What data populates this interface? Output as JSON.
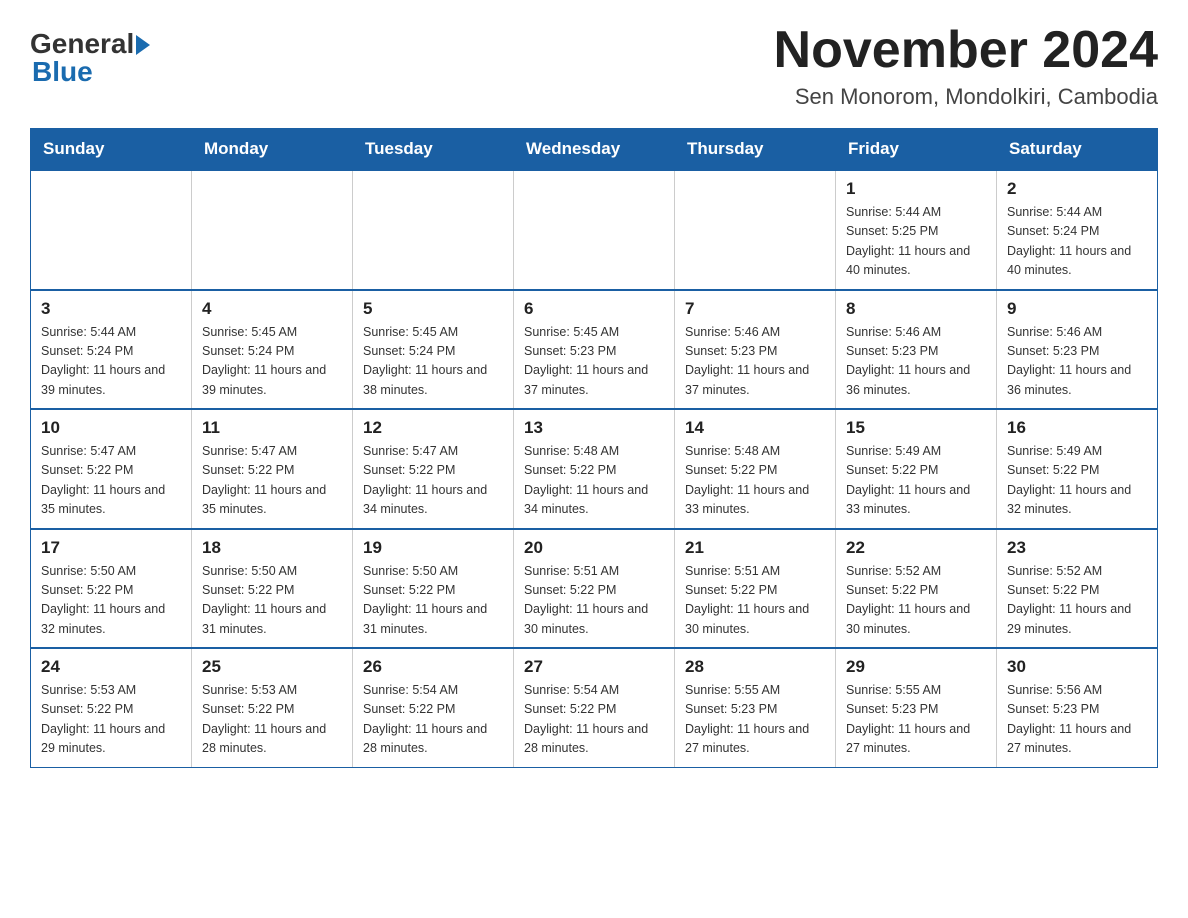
{
  "header": {
    "title": "November 2024",
    "subtitle": "Sen Monorom, Mondolkiri, Cambodia"
  },
  "logo": {
    "general": "General",
    "blue": "Blue"
  },
  "days_of_week": [
    "Sunday",
    "Monday",
    "Tuesday",
    "Wednesday",
    "Thursday",
    "Friday",
    "Saturday"
  ],
  "weeks": [
    [
      {
        "day": "",
        "info": ""
      },
      {
        "day": "",
        "info": ""
      },
      {
        "day": "",
        "info": ""
      },
      {
        "day": "",
        "info": ""
      },
      {
        "day": "",
        "info": ""
      },
      {
        "day": "1",
        "info": "Sunrise: 5:44 AM\nSunset: 5:25 PM\nDaylight: 11 hours and 40 minutes."
      },
      {
        "day": "2",
        "info": "Sunrise: 5:44 AM\nSunset: 5:24 PM\nDaylight: 11 hours and 40 minutes."
      }
    ],
    [
      {
        "day": "3",
        "info": "Sunrise: 5:44 AM\nSunset: 5:24 PM\nDaylight: 11 hours and 39 minutes."
      },
      {
        "day": "4",
        "info": "Sunrise: 5:45 AM\nSunset: 5:24 PM\nDaylight: 11 hours and 39 minutes."
      },
      {
        "day": "5",
        "info": "Sunrise: 5:45 AM\nSunset: 5:24 PM\nDaylight: 11 hours and 38 minutes."
      },
      {
        "day": "6",
        "info": "Sunrise: 5:45 AM\nSunset: 5:23 PM\nDaylight: 11 hours and 37 minutes."
      },
      {
        "day": "7",
        "info": "Sunrise: 5:46 AM\nSunset: 5:23 PM\nDaylight: 11 hours and 37 minutes."
      },
      {
        "day": "8",
        "info": "Sunrise: 5:46 AM\nSunset: 5:23 PM\nDaylight: 11 hours and 36 minutes."
      },
      {
        "day": "9",
        "info": "Sunrise: 5:46 AM\nSunset: 5:23 PM\nDaylight: 11 hours and 36 minutes."
      }
    ],
    [
      {
        "day": "10",
        "info": "Sunrise: 5:47 AM\nSunset: 5:22 PM\nDaylight: 11 hours and 35 minutes."
      },
      {
        "day": "11",
        "info": "Sunrise: 5:47 AM\nSunset: 5:22 PM\nDaylight: 11 hours and 35 minutes."
      },
      {
        "day": "12",
        "info": "Sunrise: 5:47 AM\nSunset: 5:22 PM\nDaylight: 11 hours and 34 minutes."
      },
      {
        "day": "13",
        "info": "Sunrise: 5:48 AM\nSunset: 5:22 PM\nDaylight: 11 hours and 34 minutes."
      },
      {
        "day": "14",
        "info": "Sunrise: 5:48 AM\nSunset: 5:22 PM\nDaylight: 11 hours and 33 minutes."
      },
      {
        "day": "15",
        "info": "Sunrise: 5:49 AM\nSunset: 5:22 PM\nDaylight: 11 hours and 33 minutes."
      },
      {
        "day": "16",
        "info": "Sunrise: 5:49 AM\nSunset: 5:22 PM\nDaylight: 11 hours and 32 minutes."
      }
    ],
    [
      {
        "day": "17",
        "info": "Sunrise: 5:50 AM\nSunset: 5:22 PM\nDaylight: 11 hours and 32 minutes."
      },
      {
        "day": "18",
        "info": "Sunrise: 5:50 AM\nSunset: 5:22 PM\nDaylight: 11 hours and 31 minutes."
      },
      {
        "day": "19",
        "info": "Sunrise: 5:50 AM\nSunset: 5:22 PM\nDaylight: 11 hours and 31 minutes."
      },
      {
        "day": "20",
        "info": "Sunrise: 5:51 AM\nSunset: 5:22 PM\nDaylight: 11 hours and 30 minutes."
      },
      {
        "day": "21",
        "info": "Sunrise: 5:51 AM\nSunset: 5:22 PM\nDaylight: 11 hours and 30 minutes."
      },
      {
        "day": "22",
        "info": "Sunrise: 5:52 AM\nSunset: 5:22 PM\nDaylight: 11 hours and 30 minutes."
      },
      {
        "day": "23",
        "info": "Sunrise: 5:52 AM\nSunset: 5:22 PM\nDaylight: 11 hours and 29 minutes."
      }
    ],
    [
      {
        "day": "24",
        "info": "Sunrise: 5:53 AM\nSunset: 5:22 PM\nDaylight: 11 hours and 29 minutes."
      },
      {
        "day": "25",
        "info": "Sunrise: 5:53 AM\nSunset: 5:22 PM\nDaylight: 11 hours and 28 minutes."
      },
      {
        "day": "26",
        "info": "Sunrise: 5:54 AM\nSunset: 5:22 PM\nDaylight: 11 hours and 28 minutes."
      },
      {
        "day": "27",
        "info": "Sunrise: 5:54 AM\nSunset: 5:22 PM\nDaylight: 11 hours and 28 minutes."
      },
      {
        "day": "28",
        "info": "Sunrise: 5:55 AM\nSunset: 5:23 PM\nDaylight: 11 hours and 27 minutes."
      },
      {
        "day": "29",
        "info": "Sunrise: 5:55 AM\nSunset: 5:23 PM\nDaylight: 11 hours and 27 minutes."
      },
      {
        "day": "30",
        "info": "Sunrise: 5:56 AM\nSunset: 5:23 PM\nDaylight: 11 hours and 27 minutes."
      }
    ]
  ]
}
